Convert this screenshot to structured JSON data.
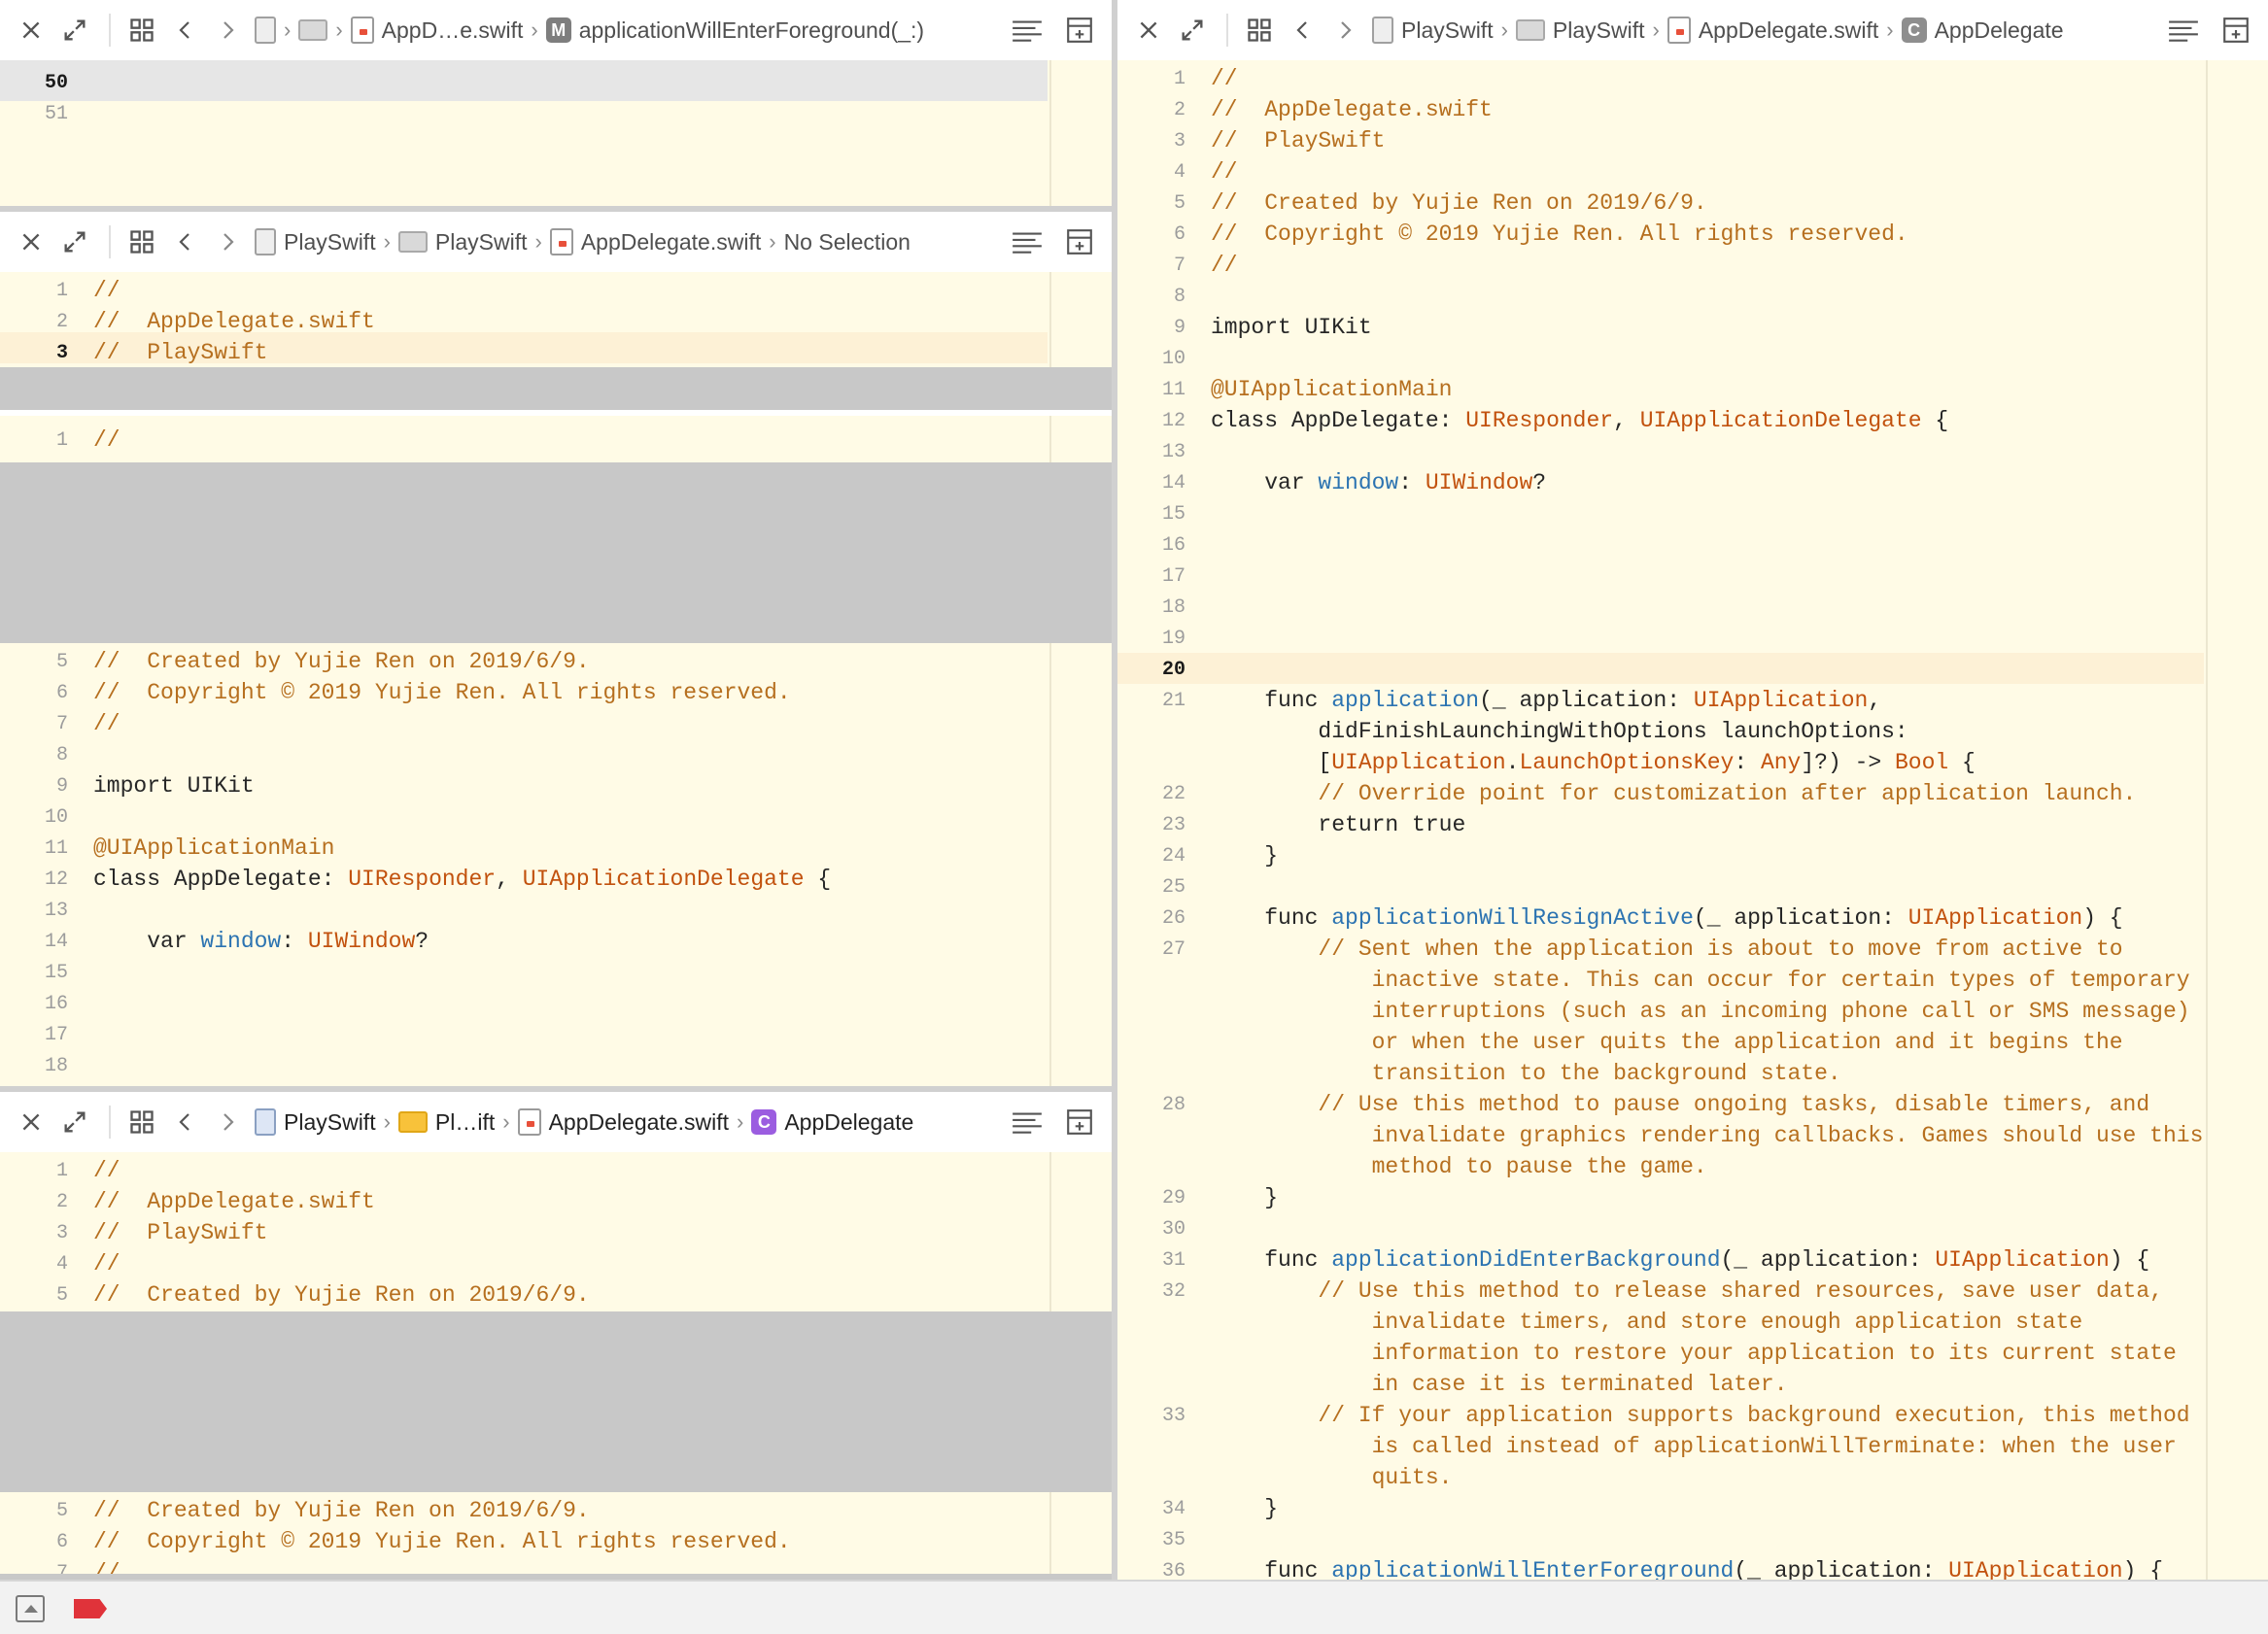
{
  "panes": {
    "top": {
      "breadcrumbs": [
        "AppD…e.swift",
        "applicationWillEnterForeground(_:)"
      ],
      "lines": [
        "50",
        "51"
      ]
    },
    "second": {
      "breadcrumbs": [
        "PlaySwift",
        "PlaySwift",
        "AppDelegate.swift",
        "No Selection"
      ],
      "lines": [
        "1",
        "2",
        "3"
      ],
      "code": [
        "//",
        "//  AppDelegate.swift",
        "//  PlaySwift"
      ],
      "below_lines": [
        "1"
      ],
      "below_code": [
        "//"
      ]
    },
    "third": {
      "lines": [
        "5",
        "6",
        "7",
        "8",
        "9",
        "10",
        "11",
        "12",
        "13",
        "14",
        "15",
        "16",
        "17",
        "18"
      ],
      "code": {
        "c5": "//  Created by Yujie Ren on 2019/6/9.",
        "c6": "//  Copyright © 2019 Yujie Ren. All rights reserved.",
        "c7": "//",
        "c9a": "import",
        "c9b": " UIKit",
        "c11": "@UIApplicationMain",
        "c12a": "class",
        "c12b": " AppDelegate: ",
        "c12c": "UIResponder",
        "c12d": ", ",
        "c12e": "UIApplicationDelegate",
        "c12f": " {",
        "c14a": "    var ",
        "c14b": "window",
        "c14c": ": ",
        "c14d": "UIWindow",
        "c14e": "?"
      }
    },
    "bottom": {
      "breadcrumbs": [
        "PlaySwift",
        "Pl…ift",
        "AppDelegate.swift",
        "AppDelegate"
      ],
      "lines": [
        "1",
        "2",
        "3",
        "4",
        "5"
      ],
      "code": [
        "//",
        "//  AppDelegate.swift",
        "//  PlaySwift",
        "//",
        "//  Created by Yujie Ren on 2019/6/9."
      ],
      "below_lines": [
        "5",
        "6",
        "7"
      ],
      "below_code": [
        "//  Created by Yujie Ren on 2019/6/9.",
        "//  Copyright © 2019 Yujie Ren. All rights reserved.",
        "//"
      ]
    },
    "right": {
      "breadcrumbs": [
        "PlaySwift",
        "PlaySwift",
        "AppDelegate.swift",
        "AppDelegate"
      ],
      "code": {
        "l1": "//",
        "l2": "//  AppDelegate.swift",
        "l3": "//  PlaySwift",
        "l4": "//",
        "l5": "//  Created by Yujie Ren on 2019/6/9.",
        "l6": "//  Copyright © 2019 Yujie Ren. All rights reserved.",
        "l7": "//",
        "l9a": "import",
        "l9b": " UIKit",
        "l11": "@UIApplicationMain",
        "l12a": "class",
        "l12b": " AppDelegate: ",
        "l12c": "UIResponder",
        "l12d": ", ",
        "l12e": "UIApplicationDelegate",
        "l12f": " {",
        "l14a": "    var ",
        "l14b": "window",
        "l14c": ": ",
        "l14d": "UIWindow",
        "l14e": "?",
        "l21a": "    func ",
        "l21b": "application",
        "l21c": "(_ application: ",
        "l21d": "UIApplication",
        "l21e": ",",
        "l21f": "        didFinishLaunchingWithOptions launchOptions:",
        "l21g": "        [",
        "l21h": "UIApplication",
        "l21i": ".",
        "l21j": "LaunchOptionsKey",
        "l21k": ": ",
        "l21l": "Any",
        "l21m": "]?) -> ",
        "l21n": "Bool",
        "l21o": " {",
        "l22": "        // Override point for customization after application launch.",
        "l23a": "        return",
        "l23b": " true",
        "l24": "    }",
        "l26a": "    func ",
        "l26b": "applicationWillResignActive",
        "l26c": "(_ application: ",
        "l26d": "UIApplication",
        "l26e": ") {",
        "l27a": "        // Sent when the application is about to move from active to",
        "l27b": "            inactive state. This can occur for certain types of temporary",
        "l27c": "            interruptions (such as an incoming phone call or SMS message)",
        "l27d": "            or when the user quits the application and it begins the",
        "l27e": "            transition to the background state.",
        "l28a": "        // Use this method to pause ongoing tasks, disable timers, and",
        "l28b": "            invalidate graphics rendering callbacks. Games should use this",
        "l28c": "            method to pause the game.",
        "l29": "    }",
        "l31a": "    func ",
        "l31b": "applicationDidEnterBackground",
        "l31c": "(_ application: ",
        "l31d": "UIApplication",
        "l31e": ") {",
        "l32a": "        // Use this method to release shared resources, save user data,",
        "l32b": "            invalidate timers, and store enough application state",
        "l32c": "            information to restore your application to its current state",
        "l32d": "            in case it is terminated later.",
        "l33a": "        // If your application supports background execution, this method",
        "l33b": "            is called instead of applicationWillTerminate: when the user",
        "l33c": "            quits.",
        "l34": "    }",
        "l36a": "    func ",
        "l36b": "applicationWillEnterForeground",
        "l36c": "(_ application: ",
        "l36d": "UIApplication",
        "l36e": ") {"
      },
      "lines": [
        "1",
        "2",
        "3",
        "4",
        "5",
        "6",
        "7",
        "8",
        "9",
        "10",
        "11",
        "12",
        "13",
        "14",
        "15",
        "16",
        "17",
        "18",
        "19",
        "20",
        "21",
        "22",
        "23",
        "24",
        "25",
        "26",
        "27",
        "28",
        "29",
        "30",
        "31",
        "32",
        "33",
        "34",
        "35",
        "36"
      ]
    }
  },
  "colors": {
    "editor_bg": "#fffbe6",
    "comment": "#b66f1f",
    "type": "#c2520e",
    "function": "#2b73b1",
    "breakpoint": "#e0333a"
  }
}
